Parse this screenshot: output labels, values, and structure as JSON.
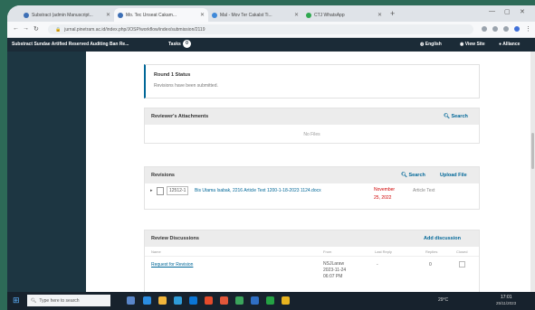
{
  "browser": {
    "tabs": [
      {
        "title": "Substract (admin Manuscript...",
        "color": "#3d6fb5"
      },
      {
        "title": "Mo. Tec Unseat Cakam...",
        "color": "#3d6fb5"
      },
      {
        "title": "Mal - Mov Ter Cakalst Ti...",
        "color": "#3f89d8"
      },
      {
        "title": "CTJ WhatsApp",
        "color": "#2fa84f"
      }
    ],
    "url": "jurnal.pinetram.ac.id/index.php/JOSP/workflow/index/submission/2119"
  },
  "site_nav": {
    "context": "Substract Sundae Artified Reserved Auditing Ban Re...",
    "tasks_label": "Tasks",
    "tasks_count": "0",
    "language": "English",
    "view_site": "View Site",
    "user": "Alliance"
  },
  "round_status": {
    "title": "Round 1 Status",
    "message": "Revisions have been submitted."
  },
  "attachments": {
    "title": "Reviewer's Attachments",
    "search_label": "Search",
    "empty_text": "No Files"
  },
  "revisions": {
    "title": "Revisions",
    "search_label": "Search",
    "upload_label": "Upload File",
    "rows": [
      {
        "id": "12512-1",
        "file": "Bis Utama Isabak, 2216 Article Text 1200-1-18-2023 1124.docx",
        "date_line1": "November",
        "date_line2": "25, 2022",
        "type": "Article Text"
      }
    ]
  },
  "discussions": {
    "title": "Review Discussions",
    "add_label": "Add discussion",
    "columns": [
      "Name",
      "From",
      "Last Reply",
      "Replies",
      "Closed"
    ],
    "rows": [
      {
        "name": "Request for Revision",
        "from_line1": "NSJLaraw",
        "from_line2": "2023-11-24",
        "from_line3": "06:07 PM",
        "last_reply": "-",
        "replies": "0"
      }
    ]
  },
  "taskbar": {
    "search_placeholder": "Type here to search",
    "weather": "29°C",
    "time": "17:01",
    "date": "25/11/2023"
  }
}
